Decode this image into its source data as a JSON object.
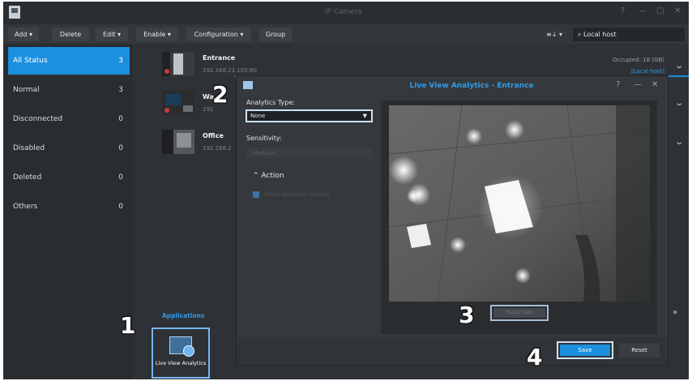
{
  "window": {
    "title": "IP Camera",
    "controls": [
      "?",
      "—",
      "□",
      "✕"
    ]
  },
  "toolbar": {
    "buttons": [
      {
        "label": "Add ▾"
      },
      {
        "label": "Delete"
      },
      {
        "label": "Edit ▾"
      },
      {
        "label": "Enable ▾"
      },
      {
        "label": "Configuration ▾"
      },
      {
        "label": "Group"
      }
    ],
    "view_label": "≡↓ ▾",
    "host_label": "Local host"
  },
  "sidebar": {
    "items": [
      {
        "label": "All Status",
        "count": "3"
      },
      {
        "label": "Normal",
        "count": "3"
      },
      {
        "label": "Disconnected",
        "count": "0"
      },
      {
        "label": "Disabled",
        "count": "0"
      },
      {
        "label": "Deleted",
        "count": "0"
      },
      {
        "label": "Others",
        "count": "0"
      }
    ],
    "applications_label": "Applications",
    "app_button_label": "Live View Analytics"
  },
  "cameras": [
    {
      "name": "Entrance",
      "ip": "192.168.23.105:80",
      "occupied": "Occupied: 18 (GB)",
      "host": "[Local host]"
    },
    {
      "name": "Wa",
      "ip": "192"
    },
    {
      "name": "Office",
      "ip": "192.168.2"
    }
  ],
  "dialog": {
    "title": "Live View Analytics - Entrance",
    "controls": [
      "?",
      "—",
      "✕"
    ],
    "analytics_type_label": "Analytics Type:",
    "analytics_type_value": "None",
    "sensitivity_label": "Sensitivity:",
    "sensitivity_value": "Medium",
    "action_section": "Action",
    "action_checkbox": "Show detection frames",
    "preview_reset_label": "Reset View",
    "save_label": "Save",
    "reset_label": "Reset"
  },
  "steps": [
    "1",
    "2",
    "3",
    "4"
  ],
  "colors": {
    "accent": "#1c8fdf",
    "highlight_border": "#cfe2f7",
    "background": "#2e3236"
  }
}
